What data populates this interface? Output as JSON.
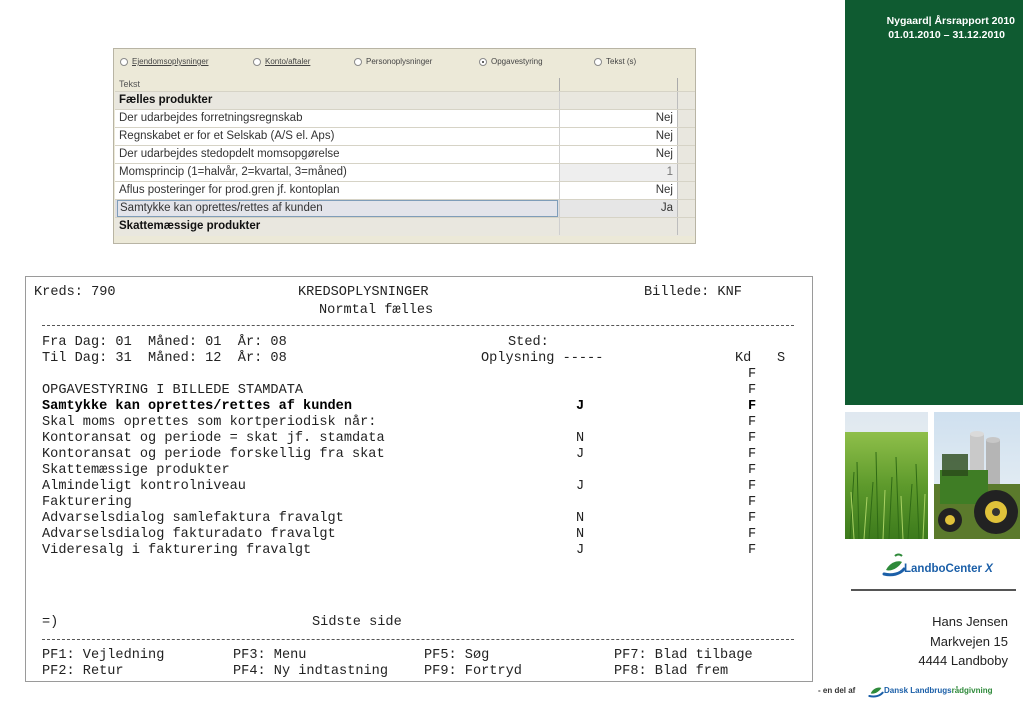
{
  "header": {
    "title": "Nygaard| Årsrapport 2010",
    "period": "01.01.2010 – 31.12.2010"
  },
  "brand": {
    "name_prefix": "LandboCenter",
    "name_suffix": "X",
    "contact": {
      "name": "Hans Jensen",
      "street": "Markvejen 15",
      "city": "4444 Landboby"
    },
    "partner_prefix": "- en del af",
    "partner_name": "Dansk Landbrugs",
    "partner_name_accent": "rådgivning"
  },
  "colors": {
    "sidebar": "#0f5b31",
    "brand_blue": "#1b5fa8",
    "brand_green": "#2e8a3a"
  },
  "grid_window": {
    "radios": [
      {
        "label": "Ejendomsoplysninger",
        "selected": false
      },
      {
        "label": "Konto/aftaler",
        "selected": false
      },
      {
        "label": "Personoplysninger",
        "selected": false
      },
      {
        "label": "Opgavestyring",
        "selected": true
      },
      {
        "label": "Tekst (s)",
        "selected": false
      }
    ],
    "column_header": "Tekst",
    "rows": [
      {
        "text": "Fælles produkter",
        "value": "",
        "kind": "group"
      },
      {
        "text": "Der udarbejdes forretningsregnskab",
        "value": "Nej",
        "kind": "normal"
      },
      {
        "text": "Regnskabet er for et Selskab (A/S el. Aps)",
        "value": "Nej",
        "kind": "normal"
      },
      {
        "text": "Der udarbejdes stedopdelt momsopgørelse",
        "value": "Nej",
        "kind": "normal"
      },
      {
        "text": "Momsprincip (1=halvår, 2=kvartal, 3=måned)",
        "value": "1",
        "kind": "gray"
      },
      {
        "text": "Aflus posteringer for prod.gren jf. kontoplan",
        "value": "Nej",
        "kind": "normal"
      },
      {
        "text": "Samtykke kan oprettes/rettes af kunden",
        "value": "Ja",
        "kind": "selected"
      },
      {
        "text": "Skattemæssige produkter",
        "value": "",
        "kind": "group"
      }
    ]
  },
  "terminal": {
    "kreds": "Kreds: 790",
    "screen_title": "KREDSOPLYSNINGER",
    "subtitle": "Normtal fælles",
    "billede": "Billede: KNF",
    "from_line": "Fra Dag: 01  Måned: 01  År: 08",
    "to_line": "Til Dag: 31  Måned: 12  År: 08",
    "sted_label": "Sted:",
    "oplysning_label": "Oplysning -----",
    "col_kd": "Kd",
    "col_s": "S",
    "rows": [
      {
        "text": "",
        "value": "",
        "kd": "F",
        "bold": false
      },
      {
        "text": "OPGAVESTYRING I BILLEDE STAMDATA",
        "value": "",
        "kd": "F",
        "bold": false
      },
      {
        "text": "Samtykke kan oprettes/rettes af kunden",
        "value": "J",
        "kd": "F",
        "bold": true
      },
      {
        "text": "Skal moms oprettes som kortperiodisk når:",
        "value": "",
        "kd": "F",
        "bold": false
      },
      {
        "text": "Kontoransat og periode = skat jf. stamdata",
        "value": "N",
        "kd": "F",
        "bold": false
      },
      {
        "text": "Kontoransat og periode forskellig fra skat",
        "value": "J",
        "kd": "F",
        "bold": false
      },
      {
        "text": "Skattemæssige produkter",
        "value": "",
        "kd": "F",
        "bold": false
      },
      {
        "text": "Almindeligt kontrolniveau",
        "value": "J",
        "kd": "F",
        "bold": false
      },
      {
        "text": "Fakturering",
        "value": "",
        "kd": "F",
        "bold": false
      },
      {
        "text": "Advarselsdialog samlefaktura fravalgt",
        "value": "N",
        "kd": "F",
        "bold": false
      },
      {
        "text": "Advarselsdialog fakturadato fravalgt",
        "value": "N",
        "kd": "F",
        "bold": false
      },
      {
        "text": "Videresalg i fakturering fravalgt",
        "value": "J",
        "kd": "F",
        "bold": false
      }
    ],
    "prompt": "=)",
    "page_status": "Sidste side",
    "function_keys": [
      [
        "PF1: Vejledning",
        "PF3: Menu",
        "PF5: Søg",
        "PF7: Blad tilbage"
      ],
      [
        "PF2: Retur",
        "PF4: Ny indtastning",
        "PF9: Fortryd",
        "PF8: Blad frem"
      ]
    ]
  }
}
